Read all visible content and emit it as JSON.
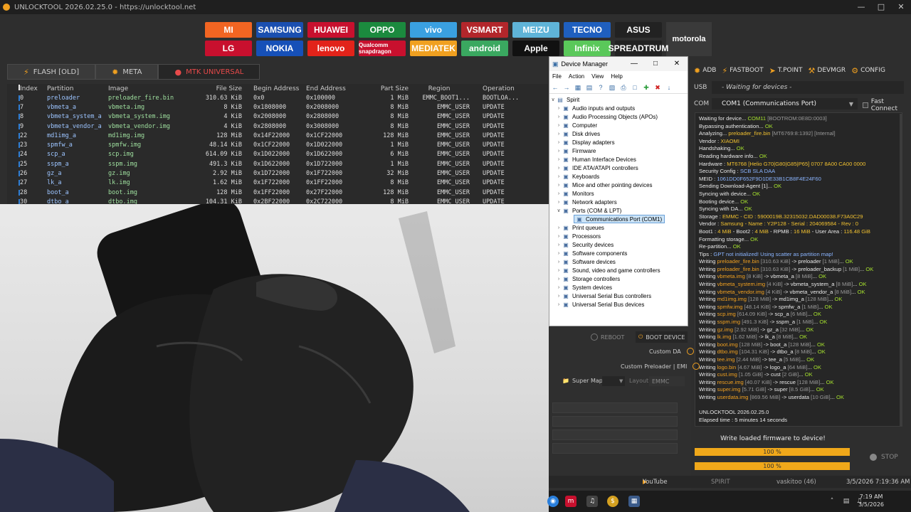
{
  "window": {
    "title": "UNLOCKTOOL 2026.02.25.0 - https://unlocktool.net"
  },
  "brands": [
    {
      "label": "MI",
      "color": "#f26522"
    },
    {
      "label": "SAMSUNG",
      "color": "#1a4fb0"
    },
    {
      "label": "HUAWEI",
      "color": "#c8102e"
    },
    {
      "label": "OPPO",
      "color": "#1b8a3e"
    },
    {
      "label": "vivo",
      "color": "#3aa0e0"
    },
    {
      "label": "VSMART",
      "color": "#b3262b"
    },
    {
      "label": "MEIZU",
      "color": "#5fb4d8"
    },
    {
      "label": "TECNO",
      "color": "#1f5fbf"
    },
    {
      "label": "ASUS",
      "color": "#222222"
    },
    {
      "label": "motorola",
      "color": "#3a3a3a"
    },
    {
      "label": "LG",
      "color": "#c8102e"
    },
    {
      "label": "NOKIA",
      "color": "#1650b8"
    },
    {
      "label": "lenovo",
      "color": "#e2231a"
    },
    {
      "label": "Qualcomm snapdragon",
      "color": "#c8102e"
    },
    {
      "label": "MEDIATEK",
      "color": "#f0a020"
    },
    {
      "label": "android",
      "color": "#3aa860"
    },
    {
      "label": "Apple",
      "color": "#111111"
    },
    {
      "label": "Infinix",
      "color": "#5ac85a"
    },
    {
      "label": "SPREADTRUM",
      "color": "#222222"
    }
  ],
  "tabs": [
    {
      "label": "FLASH [OLD]"
    },
    {
      "label": "META"
    },
    {
      "label": "MTK UNIVERSAL"
    }
  ],
  "table": {
    "headers": [
      "Index",
      "Partition",
      "Image",
      "File Size",
      "Begin Address",
      "End Address",
      "Part Size",
      "Region",
      "Operation"
    ],
    "rows": [
      {
        "idx": "0",
        "part": "preloader",
        "img": "preloader_fire.bin",
        "size": "310.63 KiB",
        "beg": "0x0",
        "end": "0x100000",
        "psz": "1 MiB",
        "reg": "EMMC_BOOT1...",
        "op": "BOOTLOA..."
      },
      {
        "idx": "7",
        "part": "vbmeta_a",
        "img": "vbmeta.img",
        "size": "8 KiB",
        "beg": "0x1808000",
        "end": "0x2008000",
        "psz": "8 MiB",
        "reg": "EMMC_USER",
        "op": "UPDATE"
      },
      {
        "idx": "8",
        "part": "vbmeta_system_a",
        "img": "vbmeta_system.img",
        "size": "4 KiB",
        "beg": "0x2008000",
        "end": "0x2808000",
        "psz": "8 MiB",
        "reg": "EMMC_USER",
        "op": "UPDATE"
      },
      {
        "idx": "9",
        "part": "vbmeta_vendor_a",
        "img": "vbmeta_vendor.img",
        "size": "4 KiB",
        "beg": "0x2808000",
        "end": "0x3008000",
        "psz": "8 MiB",
        "reg": "EMMC_USER",
        "op": "UPDATE"
      },
      {
        "idx": "22",
        "part": "md1img_a",
        "img": "md1img.img",
        "size": "128 MiB",
        "beg": "0x14F22000",
        "end": "0x1CF22000",
        "psz": "128 MiB",
        "reg": "EMMC_USER",
        "op": "UPDATE"
      },
      {
        "idx": "23",
        "part": "spmfw_a",
        "img": "spmfw.img",
        "size": "48.14 KiB",
        "beg": "0x1CF22000",
        "end": "0x1D022000",
        "psz": "1 MiB",
        "reg": "EMMC_USER",
        "op": "UPDATE"
      },
      {
        "idx": "24",
        "part": "scp_a",
        "img": "scp.img",
        "size": "614.09 KiB",
        "beg": "0x1D022000",
        "end": "0x1D622000",
        "psz": "6 MiB",
        "reg": "EMMC_USER",
        "op": "UPDATE"
      },
      {
        "idx": "25",
        "part": "sspm_a",
        "img": "sspm.img",
        "size": "491.3 KiB",
        "beg": "0x1D622000",
        "end": "0x1D722000",
        "psz": "1 MiB",
        "reg": "EMMC_USER",
        "op": "UPDATE"
      },
      {
        "idx": "26",
        "part": "gz_a",
        "img": "gz.img",
        "size": "2.92 MiB",
        "beg": "0x1D722000",
        "end": "0x1F722000",
        "psz": "32 MiB",
        "reg": "EMMC_USER",
        "op": "UPDATE"
      },
      {
        "idx": "27",
        "part": "lk_a",
        "img": "lk.img",
        "size": "1.62 MiB",
        "beg": "0x1F722000",
        "end": "0x1FF22000",
        "psz": "8 MiB",
        "reg": "EMMC_USER",
        "op": "UPDATE"
      },
      {
        "idx": "28",
        "part": "boot_a",
        "img": "boot.img",
        "size": "128 MiB",
        "beg": "0x1FF22000",
        "end": "0x27F22000",
        "psz": "128 MiB",
        "reg": "EMMC_USER",
        "op": "UPDATE"
      },
      {
        "idx": "30",
        "part": "dtbo_a",
        "img": "dtbo.img",
        "size": "104.31 KiB",
        "beg": "0x2BF22000",
        "end": "0x2C722000",
        "psz": "8 MiB",
        "reg": "EMMC_USER",
        "op": "UPDATE"
      }
    ]
  },
  "devmgr": {
    "title": "Device Manager",
    "menu": [
      "File",
      "Action",
      "View",
      "Help"
    ],
    "root": "Spirit",
    "nodes": [
      "Audio inputs and outputs",
      "Audio Processing Objects (APOs)",
      "Computer",
      "Disk drives",
      "Display adapters",
      "Firmware",
      "Human Interface Devices",
      "IDE ATA/ATAPI controllers",
      "Keyboards",
      "Mice and other pointing devices",
      "Monitors",
      "Network adapters",
      "Ports (COM & LPT)",
      "Communications Port (COM1)",
      "Print queues",
      "Processors",
      "Security devices",
      "Software components",
      "Software devices",
      "Sound, video and game controllers",
      "Storage controllers",
      "System devices",
      "Universal Serial Bus controllers",
      "Universal Serial Bus devices"
    ]
  },
  "right": {
    "toolbar": [
      "ADB",
      "FASTBOOT",
      "T.POINT",
      "DEVMGR",
      "CONFIG"
    ],
    "usb_label": "USB",
    "usb_value": "- Waiting for devices -",
    "com_label": "COM",
    "com_value": "COM1 (Communications Port)",
    "fast_connect": "Fast Connect",
    "reboot": "REBOOT",
    "boot_device": "BOOT DEVICE",
    "custom_da": "Custom DA",
    "custom_preloader": "Custom Preloader | EMI",
    "super_map": "Super Map",
    "layout": "Layout",
    "emmc": "EMMC",
    "write_label": "Write loaded firmware to device!",
    "progress1": "100 %",
    "progress2": "100 %",
    "stop": "STOP"
  },
  "log": [
    [
      [
        "Waiting for device... ",
        ""
      ],
      [
        "COM11 ",
        "ok"
      ],
      [
        "[BOOTROM:0E8D:0003]",
        "g"
      ]
    ],
    [
      [
        "Bypassing authentication... ",
        ""
      ],
      [
        "OK",
        "ok"
      ]
    ],
    [
      [
        "Analyzing... ",
        ""
      ],
      [
        "preloader_fire.bin ",
        "y"
      ],
      [
        "[MT6769:8:1392] [Internal]",
        "g"
      ]
    ],
    [
      [
        "Vendor : ",
        ""
      ],
      [
        "XIAOMI",
        "y"
      ]
    ],
    [
      [
        "Handshaking... ",
        ""
      ],
      [
        "OK",
        "ok"
      ]
    ],
    [
      [
        "Reading hardware info... ",
        ""
      ],
      [
        "OK",
        "ok"
      ]
    ],
    [
      [
        "  Hardware : ",
        ""
      ],
      [
        "MT6768 [Helio G70|G80|G85|P65] 0707 8A00 CA00 0000",
        "y"
      ]
    ],
    [
      [
        "  Security Config : ",
        ""
      ],
      [
        "SCB SLA DAA",
        "b"
      ]
    ],
    [
      [
        "  MEID : ",
        ""
      ],
      [
        "1061DD0F652F9D1DE33B1CB8F4E24F60",
        "b"
      ]
    ],
    [
      [
        "Sending Download-Agent [1]... ",
        ""
      ],
      [
        "OK",
        "ok"
      ]
    ],
    [
      [
        "Syncing with device... ",
        ""
      ],
      [
        "OK",
        "ok"
      ]
    ],
    [
      [
        "Booting device... ",
        ""
      ],
      [
        "OK",
        "ok"
      ]
    ],
    [
      [
        "Syncing with DA... ",
        ""
      ],
      [
        "OK",
        "ok"
      ]
    ],
    [
      [
        "  Storage : ",
        ""
      ],
      [
        "EMMC - CID : 5900019B.32315032.DAD00038.F73A0C29",
        "y"
      ]
    ],
    [
      [
        "  Vendor : ",
        ""
      ],
      [
        "Samsung - Name : Y2P128 - Serial : 204069584 - Rev : 0",
        "y"
      ]
    ],
    [
      [
        "  Boot1 : ",
        ""
      ],
      [
        "4 MiB",
        "y"
      ],
      [
        " - Boot2 : ",
        ""
      ],
      [
        "4 MiB",
        "y"
      ],
      [
        " - RPMB : ",
        ""
      ],
      [
        "16 MiB",
        "y"
      ],
      [
        " - User Area : ",
        ""
      ],
      [
        "116.48 GiB",
        "y"
      ]
    ],
    [
      [
        "Formatting storage... ",
        ""
      ],
      [
        "OK",
        "ok"
      ]
    ],
    [
      [
        "Re-partition... ",
        ""
      ],
      [
        "OK",
        "ok"
      ]
    ],
    [
      [
        "Tips : ",
        ""
      ],
      [
        "GPT not initialized! Using scatter as partition map!",
        "b"
      ]
    ],
    [
      [
        "Writing ",
        ""
      ],
      [
        "preloader_fire.bin ",
        "o"
      ],
      [
        "[310.63 KiB] ",
        "g"
      ],
      [
        "-> preloader ",
        ""
      ],
      [
        "[1 MiB]",
        "g"
      ],
      [
        "... ",
        ""
      ],
      [
        "OK",
        "ok"
      ]
    ],
    [
      [
        "Writing ",
        ""
      ],
      [
        "preloader_fire.bin ",
        "o"
      ],
      [
        "[310.63 KiB] ",
        "g"
      ],
      [
        "-> preloader_backup ",
        ""
      ],
      [
        "[1 MiB]",
        "g"
      ],
      [
        "... ",
        ""
      ],
      [
        "OK",
        "ok"
      ]
    ],
    [
      [
        "Writing ",
        ""
      ],
      [
        "vbmeta.img ",
        "o"
      ],
      [
        "[8 KiB] ",
        "g"
      ],
      [
        "-> vbmeta_a ",
        ""
      ],
      [
        "[8 MiB]",
        "g"
      ],
      [
        "... ",
        ""
      ],
      [
        "OK",
        "ok"
      ]
    ],
    [
      [
        "Writing ",
        ""
      ],
      [
        "vbmeta_system.img ",
        "o"
      ],
      [
        "[4 KiB] ",
        "g"
      ],
      [
        "-> vbmeta_system_a ",
        ""
      ],
      [
        "[8 MiB]",
        "g"
      ],
      [
        "... ",
        ""
      ],
      [
        "OK",
        "ok"
      ]
    ],
    [
      [
        "Writing ",
        ""
      ],
      [
        "vbmeta_vendor.img ",
        "o"
      ],
      [
        "[4 KiB] ",
        "g"
      ],
      [
        "-> vbmeta_vendor_a ",
        ""
      ],
      [
        "[8 MiB]",
        "g"
      ],
      [
        "... ",
        ""
      ],
      [
        "OK",
        "ok"
      ]
    ],
    [
      [
        "Writing ",
        ""
      ],
      [
        "md1img.img ",
        "o"
      ],
      [
        "[128 MiB] ",
        "g"
      ],
      [
        "-> md1img_a ",
        ""
      ],
      [
        "[128 MiB]",
        "g"
      ],
      [
        "... ",
        ""
      ],
      [
        "OK",
        "ok"
      ]
    ],
    [
      [
        "Writing ",
        ""
      ],
      [
        "spmfw.img ",
        "o"
      ],
      [
        "[48.14 KiB] ",
        "g"
      ],
      [
        "-> spmfw_a ",
        ""
      ],
      [
        "[1 MiB]",
        "g"
      ],
      [
        "... ",
        ""
      ],
      [
        "OK",
        "ok"
      ]
    ],
    [
      [
        "Writing ",
        ""
      ],
      [
        "scp.img ",
        "o"
      ],
      [
        "[614.09 KiB] ",
        "g"
      ],
      [
        "-> scp_a ",
        ""
      ],
      [
        "[6 MiB]",
        "g"
      ],
      [
        "... ",
        ""
      ],
      [
        "OK",
        "ok"
      ]
    ],
    [
      [
        "Writing ",
        ""
      ],
      [
        "sspm.img ",
        "o"
      ],
      [
        "[491.3 KiB] ",
        "g"
      ],
      [
        "-> sspm_a ",
        ""
      ],
      [
        "[1 MiB]",
        "g"
      ],
      [
        "... ",
        ""
      ],
      [
        "OK",
        "ok"
      ]
    ],
    [
      [
        "Writing ",
        ""
      ],
      [
        "gz.img ",
        "o"
      ],
      [
        "[2.92 MiB] ",
        "g"
      ],
      [
        "-> gz_a ",
        ""
      ],
      [
        "[32 MiB]",
        "g"
      ],
      [
        "... ",
        ""
      ],
      [
        "OK",
        "ok"
      ]
    ],
    [
      [
        "Writing ",
        ""
      ],
      [
        "lk.img ",
        "o"
      ],
      [
        "[1.62 MiB] ",
        "g"
      ],
      [
        "-> lk_a ",
        ""
      ],
      [
        "[8 MiB]",
        "g"
      ],
      [
        "... ",
        ""
      ],
      [
        "OK",
        "ok"
      ]
    ],
    [
      [
        "Writing ",
        ""
      ],
      [
        "boot.img ",
        "o"
      ],
      [
        "[128 MiB] ",
        "g"
      ],
      [
        "-> boot_a ",
        ""
      ],
      [
        "[128 MiB]",
        "g"
      ],
      [
        "... ",
        ""
      ],
      [
        "OK",
        "ok"
      ]
    ],
    [
      [
        "Writing ",
        ""
      ],
      [
        "dtbo.img ",
        "o"
      ],
      [
        "[104.31 KiB] ",
        "g"
      ],
      [
        "-> dtbo_a ",
        ""
      ],
      [
        "[8 MiB]",
        "g"
      ],
      [
        "... ",
        ""
      ],
      [
        "OK",
        "ok"
      ]
    ],
    [
      [
        "Writing ",
        ""
      ],
      [
        "tee.img ",
        "o"
      ],
      [
        "[2.44 MiB] ",
        "g"
      ],
      [
        "-> tee_a ",
        ""
      ],
      [
        "[5 MiB]",
        "g"
      ],
      [
        "... ",
        ""
      ],
      [
        "OK",
        "ok"
      ]
    ],
    [
      [
        "Writing ",
        ""
      ],
      [
        "logo.bin ",
        "o"
      ],
      [
        "[4.67 MiB] ",
        "g"
      ],
      [
        "-> logo_a ",
        ""
      ],
      [
        "[64 MiB]",
        "g"
      ],
      [
        "... ",
        ""
      ],
      [
        "OK",
        "ok"
      ]
    ],
    [
      [
        "Writing ",
        ""
      ],
      [
        "cust.img ",
        "o"
      ],
      [
        "[1.05 GiB] ",
        "g"
      ],
      [
        "-> cust ",
        ""
      ],
      [
        "[2 GiB]",
        "g"
      ],
      [
        "... ",
        ""
      ],
      [
        "OK",
        "ok"
      ]
    ],
    [
      [
        "Writing ",
        ""
      ],
      [
        "rescue.img ",
        "o"
      ],
      [
        "[40.07 KiB] ",
        "g"
      ],
      [
        "-> rescue ",
        ""
      ],
      [
        "[128 MiB]",
        "g"
      ],
      [
        "... ",
        ""
      ],
      [
        "OK",
        "ok"
      ]
    ],
    [
      [
        "Writing ",
        ""
      ],
      [
        "super.img ",
        "o"
      ],
      [
        "[5.71 GiB] ",
        "g"
      ],
      [
        "-> super ",
        ""
      ],
      [
        "[8.5 GiB]",
        "g"
      ],
      [
        "... ",
        ""
      ],
      [
        "OK",
        "ok"
      ]
    ],
    [
      [
        "Writing ",
        ""
      ],
      [
        "userdata.img ",
        "o"
      ],
      [
        "[869.56 MiB] ",
        "g"
      ],
      [
        "-> userdata ",
        ""
      ],
      [
        "[10 GiB]",
        "g"
      ],
      [
        "... ",
        ""
      ],
      [
        "OK",
        "ok"
      ]
    ],
    [
      [
        "",
        ""
      ]
    ],
    [
      [
        "UNLOCKTOOL 2026.02.25.0",
        ""
      ]
    ],
    [
      [
        "Elapsed time : 5 minutes 14 seconds",
        ""
      ]
    ]
  ],
  "status": {
    "youtube": "YouTube",
    "spirit": "SPIRIT",
    "user": "vaskitoo (46)",
    "datetime": "3/5/2026 7:19:36 AM"
  },
  "taskbar": {
    "time": "7:19 AM",
    "date": "3/5/2026"
  },
  "progress": {
    "write1": 100,
    "write2": 100
  }
}
